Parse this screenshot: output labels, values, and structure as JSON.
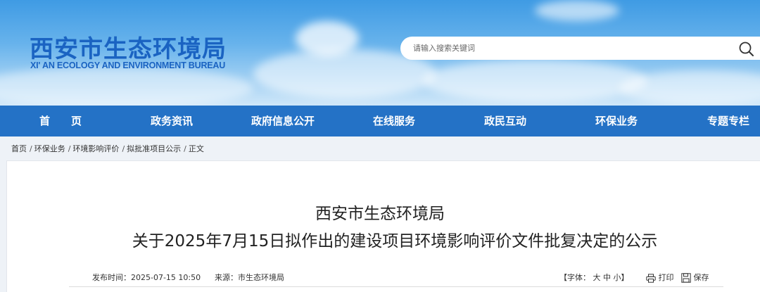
{
  "header": {
    "logo_cn": "西安市生态环境局",
    "logo_en": "XI' AN ECOLOGY AND ENVIRONMENT BUREAU",
    "search_placeholder": "请输入搜索关键词"
  },
  "nav": {
    "items": [
      "首　　页",
      "政务资讯",
      "政府信息公开",
      "在线服务",
      "政民互动",
      "环保业务",
      "专题专栏"
    ]
  },
  "breadcrumb": [
    "首页",
    "环保业务",
    "环境影响评价",
    "拟批准项目公示",
    "正文"
  ],
  "breadcrumb_sep": "/",
  "article": {
    "title_line1": "西安市生态环境局",
    "title_line2": "关于2025年7月15日拟作出的建设项目环境影响评价文件批复决定的公示",
    "publish_label": "发布时间：",
    "publish_time": "2025-07-15 10:50",
    "source_label": "来源：",
    "source": "市生态环境局",
    "font_label": "【字体：",
    "font_large": "大",
    "font_medium": "中",
    "font_small": "小",
    "font_end": "】",
    "print_label": "打印",
    "save_label": "保存"
  },
  "colors": {
    "nav_bg": "#2472c6",
    "logo": "#1a63c2"
  }
}
